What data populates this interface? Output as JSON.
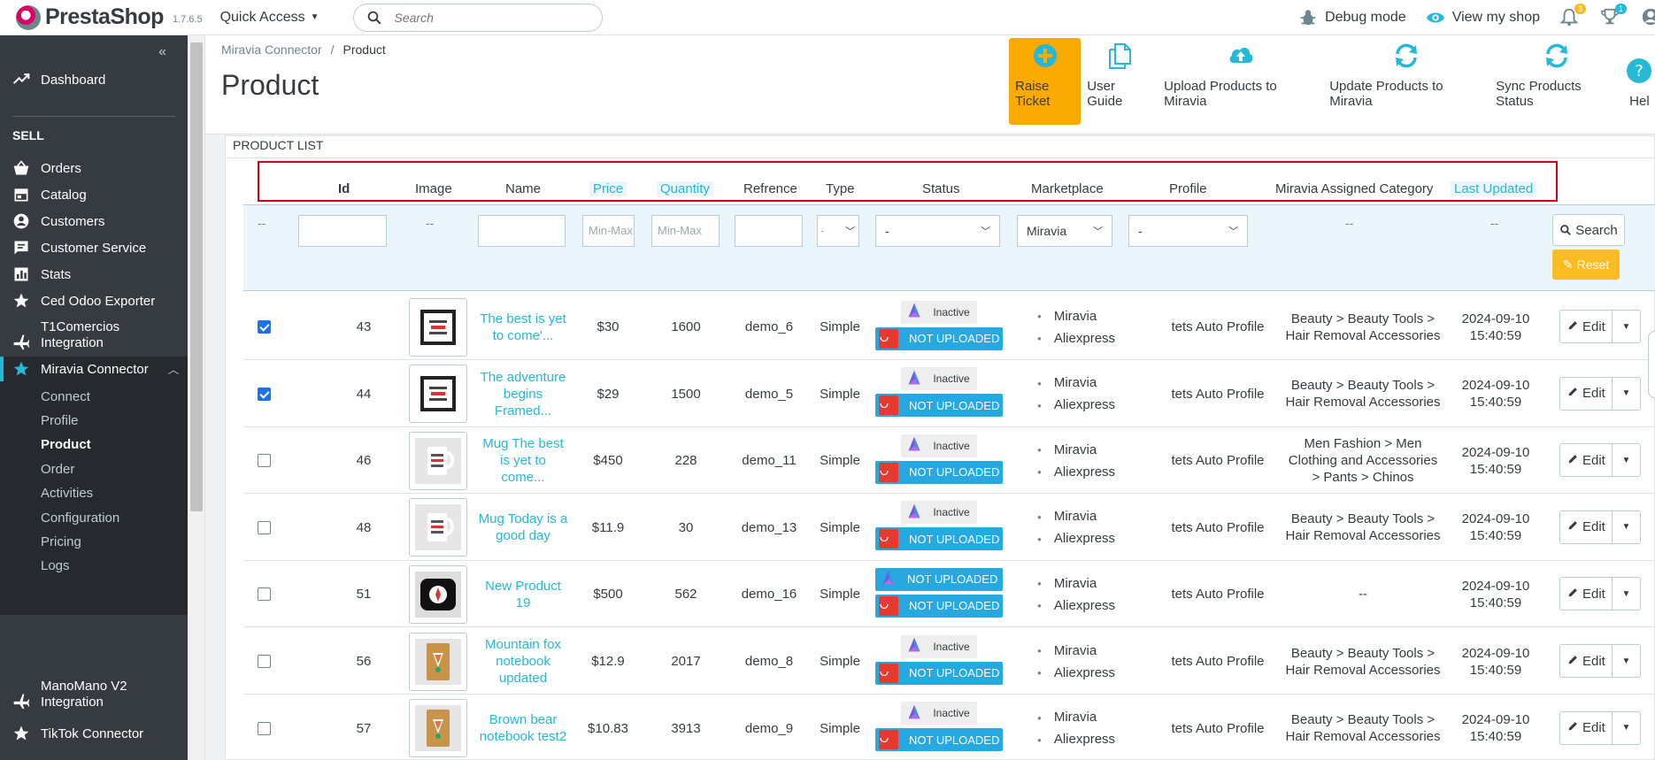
{
  "topbar": {
    "brand": "PrestaShop",
    "version": "1.7.6.5",
    "quick_access": "Quick Access",
    "search_placeholder": "Search",
    "debug_mode": "Debug mode",
    "view_shop": "View my shop",
    "notif_count": "3",
    "trophy_count": "1"
  },
  "sidebar": {
    "dashboard": "Dashboard",
    "sell_header": "SELL",
    "items": [
      {
        "label": "Orders",
        "icon": "basket-icon"
      },
      {
        "label": "Catalog",
        "icon": "store-icon"
      },
      {
        "label": "Customers",
        "icon": "person-icon"
      },
      {
        "label": "Customer Service",
        "icon": "chat-icon"
      },
      {
        "label": "Stats",
        "icon": "chart-icon"
      },
      {
        "label": "Ced Odoo Exporter",
        "icon": "star-icon"
      },
      {
        "label": "T1Comercios Integration",
        "icon": "plane-icon"
      },
      {
        "label": "Miravia Connector",
        "icon": "star-icon"
      }
    ],
    "submenu": [
      "Connect",
      "Profile",
      "Product",
      "Order",
      "Activities",
      "Configuration",
      "Pricing",
      "Logs"
    ],
    "after": [
      {
        "label": "ManoMano V2 Integration",
        "icon": "plane-icon"
      },
      {
        "label": "TikTok Connector",
        "icon": "star-icon"
      }
    ]
  },
  "header": {
    "breadcrumb_parent": "Miravia Connector",
    "breadcrumb_sep": "/",
    "breadcrumb_current": "Product",
    "title": "Product",
    "toolbar": {
      "raise_ticket": "Raise Ticket",
      "user_guide": "User Guide",
      "upload": "Upload Products to Miravia",
      "update": "Update Products to Miravia",
      "sync": "Sync Products Status",
      "help": "Hel"
    }
  },
  "list": {
    "title": "PRODUCT LIST",
    "columns": {
      "id": "Id",
      "image": "Image",
      "name": "Name",
      "price": "Price",
      "quantity": "Quantity",
      "reference": "Refrence",
      "type": "Type",
      "status": "Status",
      "marketplace": "Marketplace",
      "profile": "Profile",
      "category": "Miravia Assigned Category",
      "updated": "Last Updated"
    },
    "filters": {
      "dash": "--",
      "price_placeholder": "Min-Max",
      "qty_placeholder": "Min-Max",
      "type_value": "-",
      "status_value": "-",
      "marketplace_value": "Miravia",
      "profile_value": "-",
      "search": "Search",
      "reset": "Reset"
    },
    "status_labels": {
      "inactive": "Inactive",
      "not_uploaded": "NOT UPLOADED"
    },
    "marketplaces": [
      "Miravia",
      "Aliexpress"
    ],
    "edit": "Edit",
    "rows": [
      {
        "checked": true,
        "id": "43",
        "name": "The best is yet to come'...",
        "price": "$30",
        "qty": "1600",
        "ref": "demo_6",
        "type": "Simple",
        "miravia_status": "Inactive",
        "profile": "tets Auto Profile",
        "category": "Beauty > Beauty Tools > Hair Removal Accessories",
        "updated": "2024-09-10 15:40:59",
        "thumb": "frame"
      },
      {
        "checked": true,
        "id": "44",
        "name": "The adventure begins Framed...",
        "price": "$29",
        "qty": "1500",
        "ref": "demo_5",
        "type": "Simple",
        "miravia_status": "Inactive",
        "profile": "tets Auto Profile",
        "category": "Beauty > Beauty Tools > Hair Removal Accessories",
        "updated": "2024-09-10 15:40:59",
        "thumb": "frame"
      },
      {
        "checked": false,
        "id": "46",
        "name": "Mug The best is yet to come...",
        "price": "$450",
        "qty": "228",
        "ref": "demo_11",
        "type": "Simple",
        "miravia_status": "Inactive",
        "profile": "tets Auto Profile",
        "category": "Men Fashion > Men Clothing and Accessories > Pants > Chinos",
        "updated": "2024-09-10 15:40:59",
        "thumb": "mug"
      },
      {
        "checked": false,
        "id": "48",
        "name": "Mug Today is a good day",
        "price": "$11.9",
        "qty": "30",
        "ref": "demo_13",
        "type": "Simple",
        "miravia_status": "Inactive",
        "profile": "tets Auto Profile",
        "category": "Beauty > Beauty Tools > Hair Removal Accessories",
        "updated": "2024-09-10 15:40:59",
        "thumb": "mug"
      },
      {
        "checked": false,
        "id": "51",
        "name": "New Product 19",
        "price": "$500",
        "qty": "562",
        "ref": "demo_16",
        "type": "Simple",
        "miravia_status": "NOT UPLOADED",
        "profile": "tets Auto Profile",
        "category": "--",
        "updated": "2024-09-10 15:40:59",
        "thumb": "pillow"
      },
      {
        "checked": false,
        "id": "56",
        "name": "Mountain fox notebook updated",
        "price": "$12.9",
        "qty": "2017",
        "ref": "demo_8",
        "type": "Simple",
        "miravia_status": "Inactive",
        "profile": "tets Auto Profile",
        "category": "Beauty > Beauty Tools > Hair Removal Accessories",
        "updated": "2024-09-10 15:40:59",
        "thumb": "notebook"
      },
      {
        "checked": false,
        "id": "57",
        "name": "Brown bear notebook test2",
        "price": "$10.83",
        "qty": "3913",
        "ref": "demo_9",
        "type": "Simple",
        "miravia_status": "Inactive",
        "profile": "tets Auto Profile",
        "category": "Beauty > Beauty Tools > Hair Removal Accessories",
        "updated": "2024-09-10 15:40:59",
        "thumb": "notebook"
      }
    ]
  },
  "colors": {
    "accent": "#25b9d7",
    "warning": "#fbaa00",
    "sidebar": "#363a41",
    "upload_blue": "#25a9e0",
    "ali_red": "#e63a2e"
  }
}
